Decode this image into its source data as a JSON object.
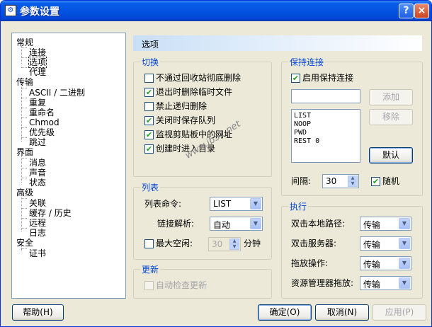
{
  "window": {
    "title": "参数设置",
    "help_btn": "?",
    "close_btn": "×"
  },
  "tree": {
    "items": [
      "常规",
      "连接",
      "选项",
      "代理",
      "传输",
      "ASCII / 二进制",
      "重复",
      "重命名",
      "Chmod",
      "优先级",
      "跳过",
      "界面",
      "消息",
      "声音",
      "状态",
      "高级",
      "关联",
      "缓存 / 历史",
      "远程",
      "日志",
      "安全",
      "证书"
    ]
  },
  "header": {
    "title": "选项"
  },
  "switch": {
    "label": "切换",
    "options": [
      "不通过回收站彻底删除",
      "退出时删除临时文件",
      "禁止递归删除",
      "关闭时保存队列",
      "监视剪贴板中的网址",
      "创建时进入目录"
    ]
  },
  "keepalive": {
    "label": "保持连接",
    "enable_label": "启用保持连接",
    "input_value": "",
    "add_btn": "添加",
    "remove_btn": "移除",
    "commands": [
      "LIST",
      "NOOP",
      "PWD",
      "REST 0"
    ],
    "default_btn": "默认",
    "interval_label": "间隔:",
    "interval_value": "30",
    "random_label": "随机"
  },
  "list": {
    "label": "列表",
    "cmd_label": "列表命令:",
    "cmd_value": "LIST",
    "link_label": "链接解析:",
    "link_value": "自动",
    "idle_label": "最大空闲:",
    "idle_value": "30",
    "idle_unit": "分钟"
  },
  "update": {
    "label": "更新",
    "auto_label": "自动检查更新"
  },
  "exec": {
    "label": "执行",
    "rows": [
      {
        "label": "双击本地路径:",
        "value": "传输"
      },
      {
        "label": "双击服务器:",
        "value": "传输"
      },
      {
        "label": "拖放操作:",
        "value": "传输"
      },
      {
        "label": "资源管理器拖放:",
        "value": "传输"
      }
    ]
  },
  "footer": {
    "help": "帮助(H)",
    "ok": "确定(O)",
    "cancel": "取消(N)",
    "apply": "应用(P)"
  },
  "watermark": "www.jb51.net"
}
